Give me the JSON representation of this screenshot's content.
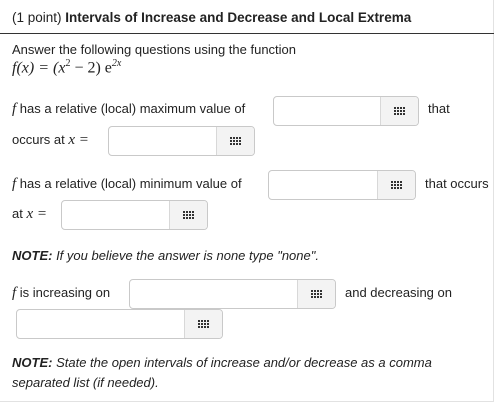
{
  "header": {
    "points": "(1 point)",
    "title": "Intervals of Increase and Decrease and Local Extrema"
  },
  "intro": "Answer the following questions using the function",
  "function_display": {
    "lhs": "f(x) = (x",
    "exp2": "2",
    "rest": " − 2) e",
    "exp_2x": "2x"
  },
  "q_max": {
    "f": "f",
    "text": " has a relative (local) maximum value of",
    "after": "that",
    "line2": "occurs at ",
    "var": "x",
    "eq": " ="
  },
  "q_min": {
    "f": "f",
    "text": " has a relative (local) minimum value of",
    "after": "that occurs",
    "line2": "at ",
    "var": "x",
    "eq": " ="
  },
  "note1": {
    "bold": "NOTE:",
    "text": " If you believe the answer is none type \"none\"."
  },
  "q_inc": {
    "f": "f",
    "text": " is increasing on",
    "after": "and decreasing on"
  },
  "note2": {
    "bold": "NOTE:",
    "text": " State the open intervals of increase and/or decrease as a comma",
    "line2": "separated list (if needed)."
  },
  "inputs": {
    "max_value": "",
    "max_at": "",
    "min_value": "",
    "min_at": "",
    "increasing": "",
    "decreasing": ""
  },
  "icons": {
    "keypad": "keypad-icon"
  },
  "colors": {
    "rule": "#333333",
    "border": "#c9c9c9",
    "button_bg": "#f3f3f3"
  }
}
